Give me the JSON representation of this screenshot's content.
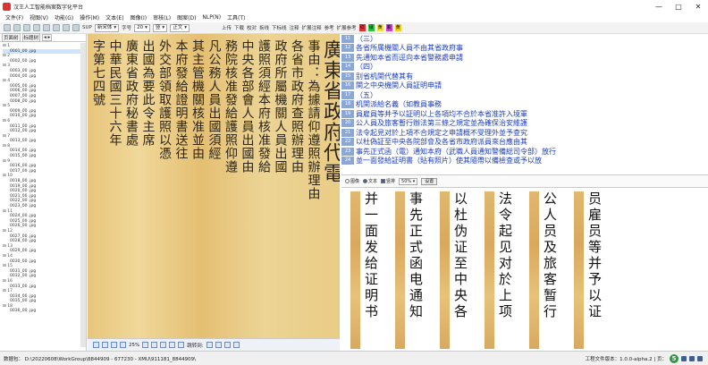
{
  "window": {
    "title": "汉王人工智能档案数字化平台",
    "min": "—",
    "max": "□",
    "close": "✕"
  },
  "menu": [
    "文件(F)",
    "视图(V)",
    "功能(G)",
    "操作(M)",
    "文本(E)",
    "图像(I)",
    "审核(L)",
    "图案(D)",
    "NLP(N)",
    "工具(T)"
  ],
  "toolbar": {
    "sup": "SUP",
    "font_size_label": "字号",
    "font_name": "新宋体",
    "font_size": "20",
    "mode": "竖",
    "chars": "正文",
    "items": [
      "上传",
      "下载",
      "校对",
      "拆线",
      "下标线",
      "注释",
      "扩展注释",
      "参考",
      "扩展参考"
    ],
    "color_buttons": [
      {
        "label": "红",
        "color": "#e03030"
      },
      {
        "label": "绿",
        "color": "#30c040"
      },
      {
        "label": "黄",
        "color": "#f0e040"
      },
      {
        "label": "紫",
        "color": "#d040d0"
      },
      {
        "label": "黄",
        "color": "#f0d020"
      }
    ]
  },
  "left_panel": {
    "tabs": [
      "页面树",
      "标题树",
      "◂ ▸"
    ],
    "tree": [
      {
        "group": "⊟ 1",
        "files": [
          "0001_00 .jpg"
        ]
      },
      {
        "group": "⊟ 2",
        "files": [
          "0002_00 .jpg"
        ]
      },
      {
        "group": "⊟ 3",
        "files": [
          "0003_00 .jpg",
          "0004_00 .jpg"
        ]
      },
      {
        "group": "⊟ 4",
        "files": [
          "0005_00 .jpg",
          "0006_00 .jpg",
          "0007_00 .jpg",
          "0008_00 .jpg"
        ]
      },
      {
        "group": "⊟ 5",
        "files": [
          "0009_00 .jpg",
          "0010_00 .jpg"
        ]
      },
      {
        "group": "⊟ 6",
        "files": [
          "0011_00 .jpg",
          "0012_00 .jpg"
        ]
      },
      {
        "group": "⊟ 7",
        "files": [
          "0013_00 .jpg"
        ]
      },
      {
        "group": "⊟ 8",
        "files": [
          "0014_00 .jpg",
          "0015_00 .jpg"
        ]
      },
      {
        "group": "⊟ 9",
        "files": [
          "0016_00 .jpg",
          "0017_00 .jpg"
        ]
      },
      {
        "group": "⊟ 10",
        "files": [
          "0018_00 .jpg",
          "0019_00 .jpg",
          "0020_00 .jpg",
          "0021_00 .jpg",
          "0022_00 .jpg",
          "0023_00 .jpg"
        ]
      },
      {
        "group": "⊟ 11",
        "files": [
          "0024_00 .jpg",
          "0025_00 .jpg",
          "0026_00 .jpg"
        ]
      },
      {
        "group": "⊟ 12",
        "files": [
          "0027_00 .jpg",
          "0028_00 .jpg"
        ]
      },
      {
        "group": "⊟ 13",
        "files": [
          "0029_00 .jpg"
        ]
      },
      {
        "group": "⊟ 14",
        "files": [
          "0030_00 .jpg"
        ]
      },
      {
        "group": "⊟ 15",
        "files": [
          "0031_00 .jpg",
          "0032_00 .jpg"
        ]
      },
      {
        "group": "⊟ 16",
        "files": [
          "0033_00 .jpg"
        ]
      },
      {
        "group": "⊟ 17",
        "files": [
          "0034_00 .jpg",
          "0035_00 .jpg"
        ]
      },
      {
        "group": "⊟ 18",
        "files": [
          "0036_00 .jpg"
        ]
      }
    ]
  },
  "scan_columns": [
    "廣東省政府代電",
    "事由：為據請仰遵照辦理由",
    "各省市政府查照辦理由",
    "政府所屬機關人員出國",
    "護照須經本府核准發給",
    "中央各部會人員出國由",
    "務院核准發給護照仰遵",
    "凡公務人員出國須經",
    "其主管機關核准並由",
    "本府發給證明書送往",
    "外交部領取護照以憑",
    "出國為要此令主席",
    "廣東省政府秘書處",
    "中華民國三十六年",
    "字第七四號"
  ],
  "scan_bottom": {
    "zoom": "25%",
    "jump_label": "跳转到:"
  },
  "text_lines": [
    {
      "n": "11",
      "text": "（三）",
      "red": ""
    },
    {
      "n": "12",
      "text": "各省所属機關人員不由其省政府事",
      "red": "不由"
    },
    {
      "n": "13",
      "text": "先通知本省而逕向本省警務處申請",
      "red": ""
    },
    {
      "n": "14",
      "text": "（四）",
      "red": ""
    },
    {
      "n": "15",
      "text": "别省机関代替其有",
      "red": ""
    },
    {
      "n": "16",
      "text": "関之中央機関人員証明申請",
      "red": ""
    },
    {
      "n": "17",
      "text": "（五）",
      "red": ""
    },
    {
      "n": "18",
      "text": "机関派給名義（如教員事務",
      "red": ""
    },
    {
      "n": "19",
      "text": "員雇員等并予以証明以上各項均不合於本省准許入境軍",
      "red": ""
    },
    {
      "n": "20",
      "text": "公人員及旅客暫行辦法第三條之規定並為確保治安維護",
      "red": ""
    },
    {
      "n": "21",
      "text": "法令起見对於上項不合規定之申請概不受理外並予查究",
      "red": ""
    },
    {
      "n": "22",
      "text": "以杜偽証至中央各院部會及各省市政府派員來台應由其",
      "red": ""
    },
    {
      "n": "23",
      "text": "事先正式函（電）通知本府（武職人員通知警備総司令部）放行",
      "red": ""
    },
    {
      "n": "24",
      "text": "並一面發給証明書（貼有照片）使其隨帶以備檢查或予以放",
      "red": ""
    }
  ],
  "mid_bar": {
    "opt1": "图像",
    "opt2": "文本",
    "opt3": "竖排",
    "zoom": "50%",
    "btn": "设置"
  },
  "strips": [
    {
      "text": "并一面发给证明书",
      "faint": false
    },
    {
      "text": "事先正式函电通知",
      "faint": false
    },
    {
      "text": "以杜伪证至中央各",
      "faint": false
    },
    {
      "text": "法令起见对於上项",
      "faint": false
    },
    {
      "text": "公人员及旅客暂行",
      "faint": false
    },
    {
      "text": "员雇员等并予以证",
      "faint": false
    }
  ],
  "status": {
    "left": "数据包：  D:\\20220608\\WorkGroup\\8844909 - 677230 - XMU\\911181_8844909\\",
    "right": "工程文件版本：1.0.0-alpha.2 | 页：",
    "icon_s": "5"
  }
}
